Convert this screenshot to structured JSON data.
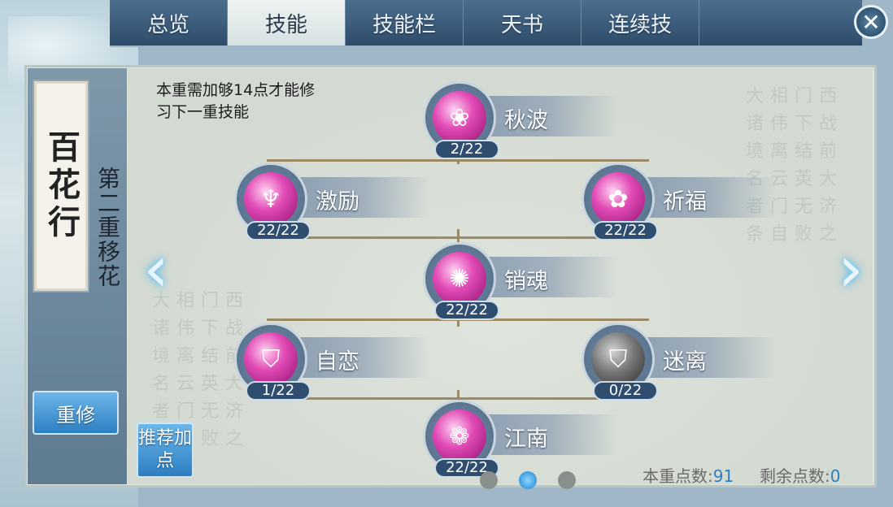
{
  "tabs": [
    {
      "label": "总览",
      "active": false
    },
    {
      "label": "技能",
      "active": true
    },
    {
      "label": "技能栏",
      "active": false
    },
    {
      "label": "天书",
      "active": false
    },
    {
      "label": "连续技",
      "active": false
    }
  ],
  "close_glyph": "✕",
  "school": {
    "name": "百花行",
    "tier": "第二重移花"
  },
  "requirement_text": "本重需加够14点才能修习下一重技能",
  "buttons": {
    "reset": "重修",
    "suggest": "推荐加点"
  },
  "skills": [
    {
      "name": "秋波",
      "count": "2/22",
      "icon": "pink-petal-orb"
    },
    {
      "name": "激励",
      "count": "22/22",
      "icon": "pink-emblem-orb"
    },
    {
      "name": "祈福",
      "count": "22/22",
      "icon": "pink-lotus-orb"
    },
    {
      "name": "销魂",
      "count": "22/22",
      "icon": "pink-swirl-orb"
    },
    {
      "name": "自恋",
      "count": "1/22",
      "icon": "pink-shield-orb"
    },
    {
      "name": "迷离",
      "count": "0/22",
      "icon": "grey-shield-orb"
    },
    {
      "name": "江南",
      "count": "22/22",
      "icon": "pink-flower-orb"
    }
  ],
  "stats": {
    "tier_points_label": "本重点数:",
    "tier_points": "91",
    "remaining_label": "剩余点数:",
    "remaining": "0"
  },
  "pagination": {
    "pages": 3,
    "current": 2
  },
  "arrows": {
    "left": "‹",
    "right": "›"
  }
}
